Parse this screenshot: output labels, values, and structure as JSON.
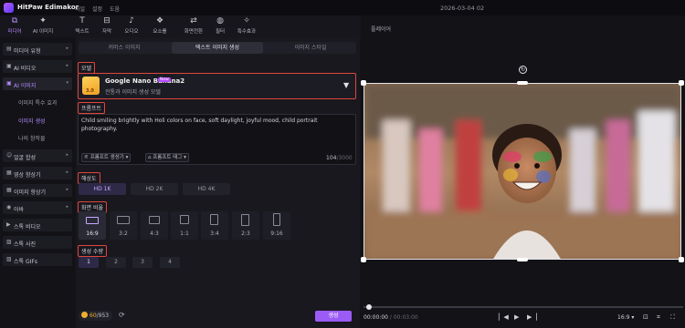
{
  "app": {
    "name": "HitPaw Edimakor",
    "menu": [
      "파일",
      "설정",
      "도움"
    ],
    "datetime": "2026-03-04 02"
  },
  "toolbar": {
    "items": [
      {
        "label": "미디어",
        "icon": "media-icon"
      },
      {
        "label": "AI 이미지",
        "icon": "ai-image-icon"
      },
      {
        "label": "텍스트",
        "icon": "text-icon"
      },
      {
        "label": "자막",
        "icon": "subtitle-icon"
      },
      {
        "label": "오디오",
        "icon": "audio-icon"
      },
      {
        "label": "요소를",
        "icon": "element-icon"
      },
      {
        "label": "화면전환",
        "icon": "transition-icon"
      },
      {
        "label": "필터",
        "icon": "filter-icon"
      },
      {
        "label": "특수효과",
        "icon": "effects-icon"
      }
    ],
    "active_index": 0
  },
  "leftnav": {
    "items": [
      {
        "label": "미디어 유형",
        "icon": "folder-icon",
        "chevron": "▸"
      },
      {
        "label": "AI 비디오",
        "icon": "ai-video-icon",
        "chevron": "▸"
      },
      {
        "label": "AI 이미지",
        "icon": "ai-image-icon",
        "chevron": "▾"
      },
      {
        "label": "얼굴 합성",
        "icon": "face-icon",
        "chevron": "▸"
      },
      {
        "label": "영상 향상기",
        "icon": "enhance-icon",
        "chevron": "▸"
      },
      {
        "label": "이미지 향상기",
        "icon": "image-enhance-icon",
        "chevron": "▸"
      },
      {
        "label": "아바",
        "icon": "avatar-icon",
        "chevron": "▸"
      },
      {
        "label": "스톡 비디오",
        "icon": "stock-video-icon",
        "chevron": ""
      },
      {
        "label": "스톡 사진",
        "icon": "stock-photo-icon",
        "chevron": ""
      },
      {
        "label": "스톡 GIFs",
        "icon": "stock-gif-icon",
        "chevron": ""
      }
    ],
    "subitems": [
      "이미지 특수 효과",
      "이미지 생성",
      "나의 창작물"
    ]
  },
  "tabs": [
    "커머스 이미지",
    "텍스트 이미지 생성",
    "이미지 스타일"
  ],
  "model": {
    "section": "모델",
    "name": "Google Nano Banana2",
    "badge": "New",
    "desc": "전통과 이미지 생성 모델",
    "icon_text": "3.0"
  },
  "prompt": {
    "section": "프롬프트",
    "text": "Child smiling brightly with Holi colors on face, soft daylight, joyful mood, child portrait photography.",
    "chip1": "프롬프트 생성기",
    "chip2": "프롬프트 태그",
    "count": "104",
    "max": "/3000"
  },
  "resolution": {
    "section": "해상도",
    "options": [
      "HD 1K",
      "HD 2K",
      "HD 4K"
    ],
    "selected": 0
  },
  "ratio": {
    "section": "화면 비율",
    "options": [
      "16:9",
      "3:2",
      "4:3",
      "1:1",
      "3:4",
      "2:3",
      "9:16"
    ],
    "selected": 0
  },
  "quantity": {
    "section": "생성 수량",
    "options": [
      "1",
      "2",
      "3",
      "4"
    ],
    "selected": 0
  },
  "footer": {
    "credits_current": "60",
    "credits_total": "/953",
    "generate": "생성"
  },
  "player": {
    "label": "플레이어",
    "time_current": "00:00:00",
    "time_total": "/ 00:03:00",
    "aspect": "16:9"
  }
}
